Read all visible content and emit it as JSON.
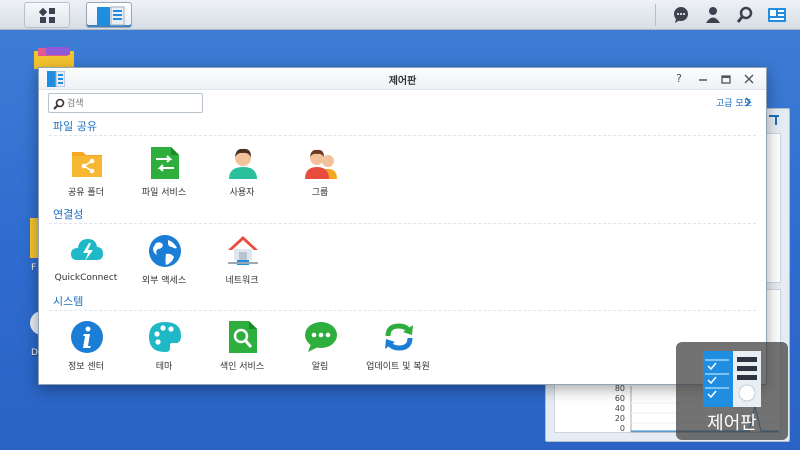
{
  "window": {
    "title": "제어판"
  },
  "search": {
    "placeholder": "검색"
  },
  "advanced_mode": "고급 모드",
  "sections": [
    {
      "title": "파일 공유",
      "items": [
        {
          "label": "공유 폴더",
          "icon": "shared-folder-icon"
        },
        {
          "label": "파일 서비스",
          "icon": "file-services-icon"
        },
        {
          "label": "사용자",
          "icon": "user-icon"
        },
        {
          "label": "그룹",
          "icon": "group-icon"
        }
      ]
    },
    {
      "title": "연결성",
      "items": [
        {
          "label": "QuickConnect",
          "icon": "quickconnect-icon"
        },
        {
          "label": "외부 액세스",
          "icon": "external-access-icon"
        },
        {
          "label": "네트워크",
          "icon": "network-icon"
        }
      ]
    },
    {
      "title": "시스템",
      "items": [
        {
          "label": "정보 센터",
          "icon": "info-center-icon"
        },
        {
          "label": "테마",
          "icon": "theme-icon"
        },
        {
          "label": "색인 서비스",
          "icon": "indexing-service-icon"
        },
        {
          "label": "알림",
          "icon": "notification-icon"
        },
        {
          "label": "업데이트 및 복원",
          "icon": "update-restore-icon"
        }
      ]
    }
  ],
  "overlay": {
    "label": "제어판"
  },
  "widget_chart": {
    "ticks": [
      "80",
      "60",
      "40",
      "20",
      "0"
    ]
  },
  "desktop_labels": [
    "F",
    "D"
  ],
  "colors": {
    "accent": "#1f6fc0",
    "desktop": "#2f6ccf"
  }
}
